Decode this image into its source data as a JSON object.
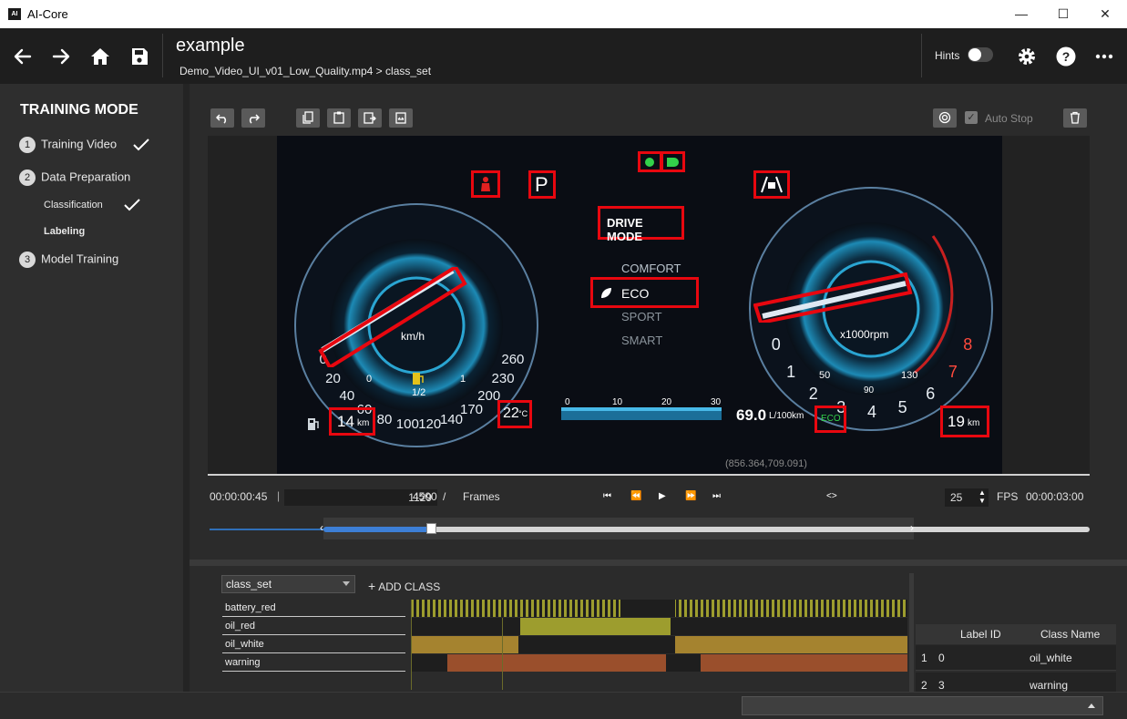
{
  "window": {
    "title": "AI-Core",
    "logo_text": "AI",
    "minimize": "—",
    "maximize": "☐",
    "close": "✕"
  },
  "header": {
    "project_title": "example",
    "breadcrumb": "Demo_Video_UI_v01_Low_Quality.mp4 > class_set",
    "hints_label": "Hints",
    "hints_enabled": false
  },
  "sidebar": {
    "mode_title": "TRAINING MODE",
    "steps": [
      {
        "num": "1",
        "label": "Training Video",
        "done": true
      },
      {
        "num": "2",
        "label": "Data Preparation",
        "done": false
      },
      {
        "num": "3",
        "label": "Model Training",
        "done": false
      }
    ],
    "substeps": [
      {
        "label": "Classification",
        "done": true
      },
      {
        "label": "Labeling",
        "active": true
      }
    ]
  },
  "toolbar": {
    "auto_stop_label": "Auto Stop",
    "auto_stop_checked": true,
    "icons": [
      "undo-icon",
      "redo-icon",
      "copy-icon",
      "paste-icon",
      "paste-next-icon",
      "paste-range-icon",
      "target-icon",
      "trash-icon"
    ]
  },
  "video": {
    "coordinate_readout": "(856.364,709.091)",
    "dashboard_text": {
      "drive_mode": "DRIVE MODE",
      "comfort": "COMFORT",
      "eco": "ECO",
      "sport": "SPORT",
      "smart": "SMART",
      "park": "P",
      "range_left": "14",
      "range_left_unit": "km",
      "temp": "22",
      "temp_unit": "°C",
      "efficiency": "69.0",
      "efficiency_unit": "L/100km",
      "eco_badge": "ECO",
      "range_right": "19",
      "range_right_unit": "km",
      "speed_unit": "km/h",
      "rpm_unit": "x1000rpm",
      "fuel_scale": [
        "0",
        "1/2",
        "1"
      ],
      "temp_scale": [
        "50",
        "90",
        "130"
      ],
      "bar_scale": [
        "0",
        "10",
        "20",
        "30"
      ],
      "speed_ticks": [
        "0",
        "20",
        "40",
        "60",
        "80",
        "100",
        "120",
        "140",
        "170",
        "200",
        "230",
        "260"
      ],
      "rpm_ticks": [
        "0",
        "1",
        "2",
        "3",
        "4",
        "5",
        "6",
        "7",
        "8"
      ]
    }
  },
  "timeline": {
    "current_time": "00:00:00:45",
    "frame_current": "1129",
    "frame_separator": "/",
    "frame_total": "4500",
    "frames_label": "Frames",
    "fps_value": "25",
    "fps_label": "FPS",
    "end_time": "00:00:03:00",
    "progress": 0.25
  },
  "labeling": {
    "class_set": "class_set",
    "add_class_label": "ADD CLASS",
    "classes": [
      {
        "name": "battery_red"
      },
      {
        "name": "oil_red"
      },
      {
        "name": "oil_white"
      },
      {
        "name": "warning"
      }
    ]
  },
  "label_table": {
    "headers": [
      "Label ID",
      "Class Name"
    ],
    "rows": [
      {
        "index": "1",
        "label_id": "0",
        "class_name": "oil_white"
      },
      {
        "index": "2",
        "label_id": "3",
        "class_name": "warning"
      }
    ]
  },
  "colors": {
    "bbox": "#e8070f",
    "track_yellow": "#9d9d2e",
    "track_tan": "#a5832f",
    "track_rust": "#9a4f2c",
    "accent_blue": "#3d7fd6"
  }
}
